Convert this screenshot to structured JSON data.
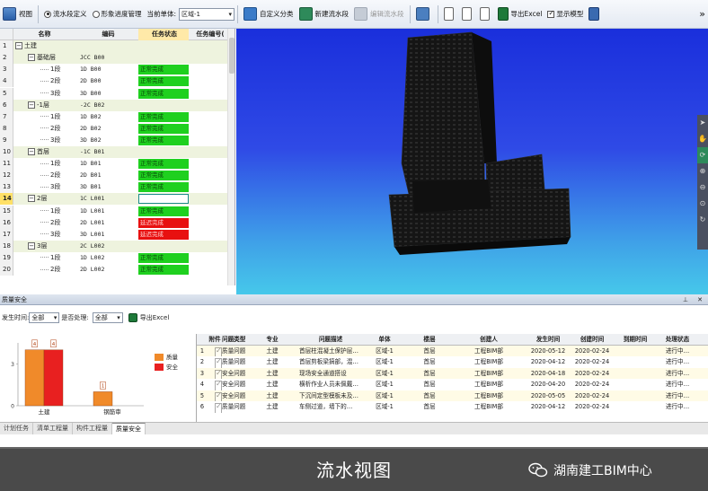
{
  "toolbar": {
    "view_label": "视图",
    "radio_flow": "流水段定义",
    "radio_image": "形象进度管理",
    "current_unit_label": "当前单体:",
    "current_unit_value": "区域-1",
    "custom_class": "自定义分类",
    "new_flow": "新建流水段",
    "edit_flow": "编辑流水段",
    "export_excel": "导出Excel",
    "show_model": "显示模型",
    "more": "»"
  },
  "grid": {
    "headers": [
      "名称",
      "编码",
      "任务状态",
      "任务编号("
    ],
    "rows": [
      {
        "no": "1",
        "name": "土建",
        "code": "",
        "status": "",
        "level": 0,
        "group": true,
        "sign": "−"
      },
      {
        "no": "2",
        "name": "基础层",
        "code": "JCC B00",
        "status": "",
        "level": 1,
        "group": true,
        "sign": "−"
      },
      {
        "no": "3",
        "name": "1段",
        "code": "1D B00",
        "status": "正常完成",
        "state": "ok",
        "level": 2
      },
      {
        "no": "4",
        "name": "2段",
        "code": "2D B00",
        "status": "正常完成",
        "state": "ok",
        "level": 2
      },
      {
        "no": "5",
        "name": "3段",
        "code": "3D B00",
        "status": "正常完成",
        "state": "ok",
        "level": 2
      },
      {
        "no": "6",
        "name": "-1层",
        "code": "-2C B02",
        "status": "",
        "level": 1,
        "group": true,
        "sign": "−"
      },
      {
        "no": "7",
        "name": "1段",
        "code": "1D B02",
        "status": "正常完成",
        "state": "ok",
        "level": 2
      },
      {
        "no": "8",
        "name": "2段",
        "code": "2D B02",
        "status": "正常完成",
        "state": "ok",
        "level": 2
      },
      {
        "no": "9",
        "name": "3段",
        "code": "3D B02",
        "status": "正常完成",
        "state": "ok",
        "level": 2
      },
      {
        "no": "10",
        "name": "首层",
        "code": "-1C B01",
        "status": "",
        "level": 1,
        "group": true,
        "sign": "−"
      },
      {
        "no": "11",
        "name": "1段",
        "code": "1D B01",
        "status": "正常完成",
        "state": "ok",
        "level": 2
      },
      {
        "no": "12",
        "name": "2段",
        "code": "2D B01",
        "status": "正常完成",
        "state": "ok",
        "level": 2
      },
      {
        "no": "13",
        "name": "3段",
        "code": "3D B01",
        "status": "正常完成",
        "state": "ok",
        "level": 2
      },
      {
        "no": "14",
        "name": "2层",
        "code": "1C L001",
        "status": "",
        "state": "sel",
        "level": 1,
        "group": true,
        "sign": "−"
      },
      {
        "no": "15",
        "name": "1段",
        "code": "1D L001",
        "status": "正常完成",
        "state": "ok",
        "level": 2
      },
      {
        "no": "16",
        "name": "2段",
        "code": "2D L001",
        "status": "延迟完成",
        "state": "late",
        "level": 2
      },
      {
        "no": "17",
        "name": "3段",
        "code": "3D L001",
        "status": "延迟完成",
        "state": "late",
        "level": 2
      },
      {
        "no": "18",
        "name": "3层",
        "code": "2C L002",
        "status": "",
        "level": 1,
        "group": true,
        "sign": "−"
      },
      {
        "no": "19",
        "name": "1段",
        "code": "1D L002",
        "status": "正常完成",
        "state": "ok",
        "level": 2
      },
      {
        "no": "20",
        "name": "2段",
        "code": "2D L002",
        "status": "正常完成",
        "state": "ok",
        "level": 2
      }
    ]
  },
  "panel": {
    "title": "质量安全",
    "time_label": "发生时间:",
    "time_value": "全部",
    "pending_label": "是否处理:",
    "pending_value": "全部",
    "export": "导出Excel"
  },
  "chart_data": {
    "type": "bar",
    "categories": [
      "土建",
      "钢筋审"
    ],
    "series": [
      {
        "name": "质量",
        "values": [
          4,
          1
        ],
        "color": "#f08a2a"
      },
      {
        "name": "安全",
        "values": [
          4,
          0
        ],
        "color": "#e82020"
      }
    ],
    "data_labels": [
      "4",
      "4",
      "1"
    ],
    "y_ticks": [
      "3",
      "0"
    ],
    "ylim": [
      0,
      4.5
    ]
  },
  "issues": {
    "headers": [
      "附件",
      "问题类型",
      "专业",
      "问题描述",
      "单体",
      "楼层",
      "创建人",
      "发生时间",
      "创建时间",
      "到期时间",
      "处理状态"
    ],
    "rows": [
      [
        "1",
        "",
        "质量问题",
        "土建",
        "首层柱混凝土保护层…",
        "区域-1",
        "首层",
        "工程BIM部",
        "2020-05-12",
        "2020-02-24",
        "",
        "进行中…"
      ],
      [
        "2",
        "",
        "质量问题",
        "土建",
        "首层剪板梁搞部，混…",
        "区域-1",
        "首层",
        "工程BIM部",
        "2020-04-12",
        "2020-02-24",
        "",
        "进行中…"
      ],
      [
        "3",
        "",
        "安全问题",
        "土建",
        "现场安全通道搭设",
        "区域-1",
        "首层",
        "工程BIM部",
        "2020-04-18",
        "2020-02-24",
        "",
        "进行中…"
      ],
      [
        "4",
        "",
        "安全问题",
        "土建",
        "横析作业人员未佩戴…",
        "区域-1",
        "首层",
        "工程BIM部",
        "2020-04-20",
        "2020-02-24",
        "",
        "进行中…"
      ],
      [
        "5",
        "",
        "安全问题",
        "土建",
        "下沉间定型模板未及…",
        "区域-1",
        "首层",
        "工程BIM部",
        "2020-05-05",
        "2020-02-24",
        "",
        "进行中…"
      ],
      [
        "6",
        "",
        "质量问题",
        "土建",
        "车侧过道，墙下的…",
        "区域-1",
        "首层",
        "工程BIM部",
        "2020-04-12",
        "2020-02-24",
        "",
        "进行中…"
      ]
    ]
  },
  "bottom_tabs": [
    "计划任务",
    "清单工程量",
    "构件工程量",
    "质量安全"
  ],
  "caption": {
    "title": "流水视图",
    "brand": "湖南建工BIM中心"
  }
}
